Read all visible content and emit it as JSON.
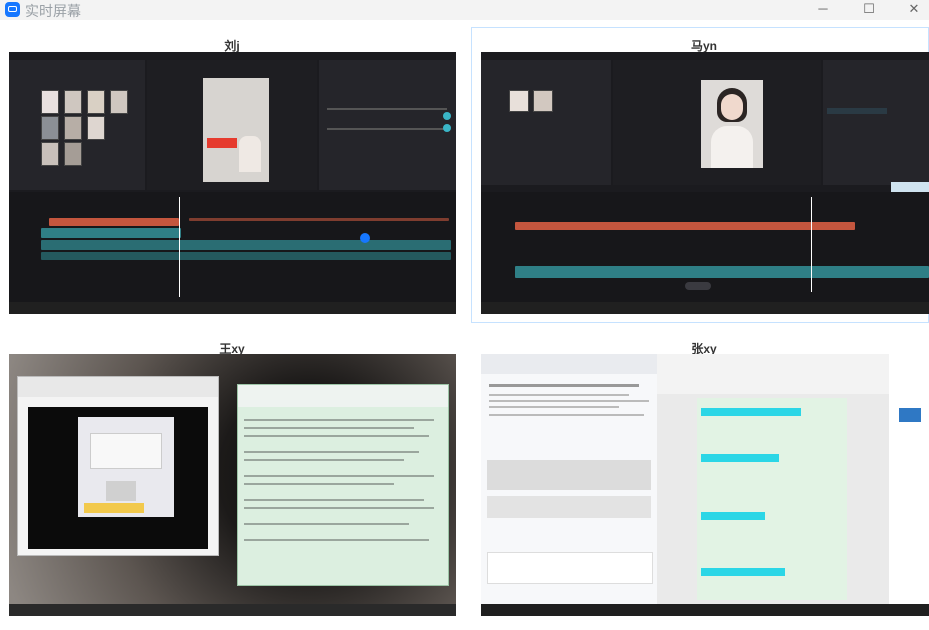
{
  "window": {
    "title": "实时屏幕",
    "minimize_icon": "minimize-icon",
    "maximize_icon": "maximize-icon",
    "close_icon": "close-icon"
  },
  "screens": [
    {
      "name": "刘j"
    },
    {
      "name": "马yn"
    },
    {
      "name": "王xy"
    },
    {
      "name": "张xy"
    }
  ],
  "colors": {
    "accent": "#1677ff",
    "editor_bg": "#1b1b1f",
    "track_video": "#2f7f86",
    "track_text": "#c4563e",
    "doc_highlight": "#2bd6e6",
    "doc_green": "#c6efce"
  }
}
